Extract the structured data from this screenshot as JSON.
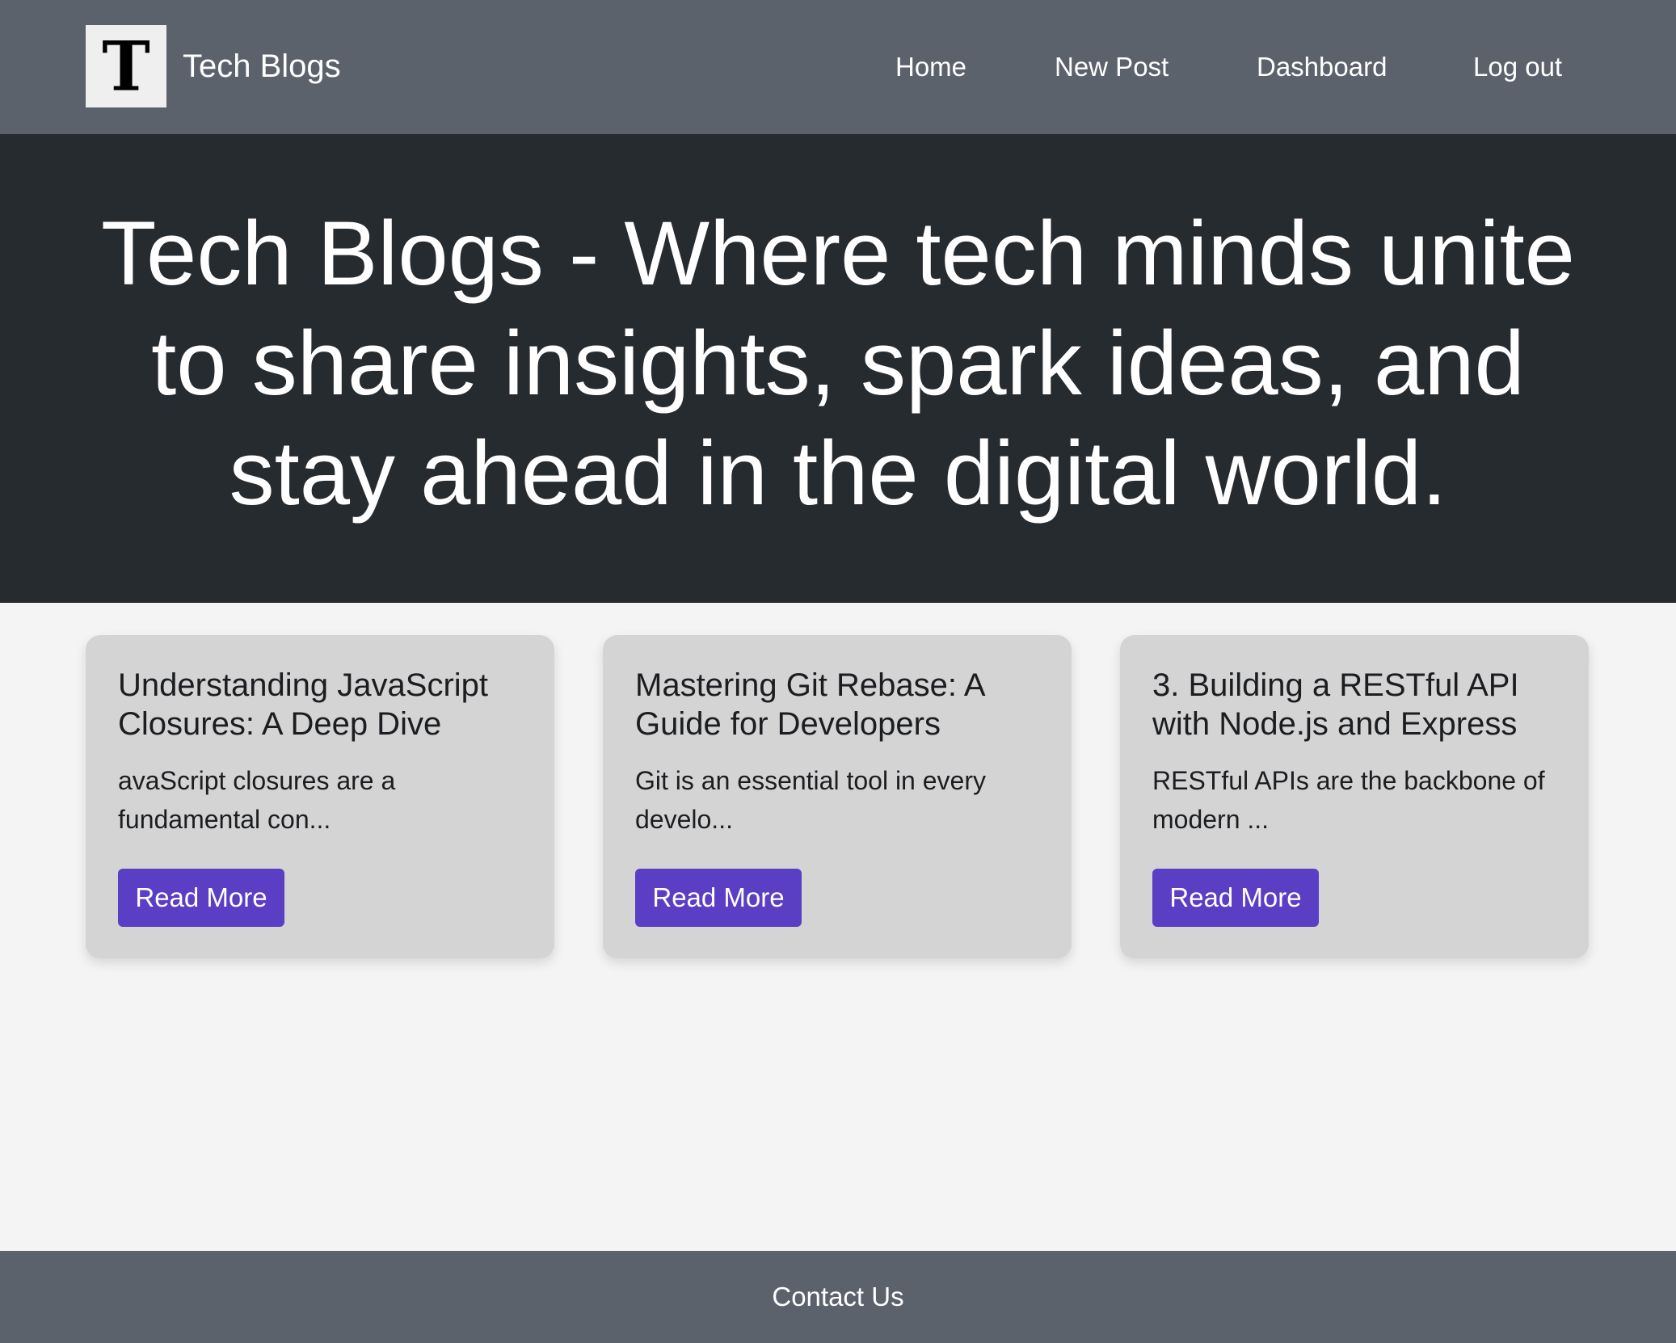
{
  "header": {
    "logo_letter": "T",
    "brand_name": "Tech Blogs",
    "nav": {
      "home": "Home",
      "new_post": "New Post",
      "dashboard": "Dashboard",
      "logout": "Log out"
    }
  },
  "hero": {
    "title": "Tech Blogs - Where tech minds unite to share insights, spark ideas, and stay ahead in the digital world."
  },
  "posts": [
    {
      "title": "Understanding JavaScript Closures: A Deep Dive",
      "excerpt": "avaScript closures are a fundamental con...",
      "button": "Read More"
    },
    {
      "title": "Mastering Git Rebase: A Guide for Developers",
      "excerpt": "Git is an essential tool in every develo...",
      "button": "Read More"
    },
    {
      "title": "3. Building a RESTful API with Node.js and Express",
      "excerpt": "RESTful APIs are the backbone of modern ...",
      "button": "Read More"
    }
  ],
  "footer": {
    "contact": "Contact Us"
  },
  "colors": {
    "nav_bg": "#5b626b",
    "hero_bg": "#262b30",
    "page_bg": "#f4f4f4",
    "card_bg": "#d4d4d4",
    "button_bg": "#5a3fc4"
  },
  "icons": {
    "logo": "letter-t-logo-icon"
  }
}
